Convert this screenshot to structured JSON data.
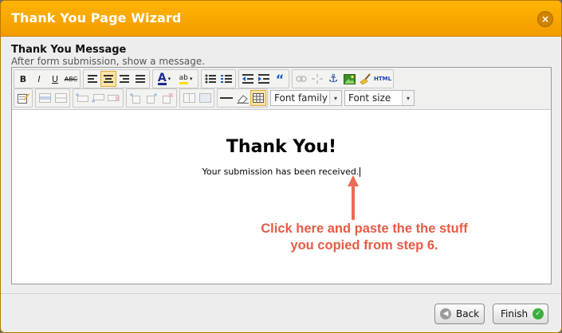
{
  "dialog": {
    "title": "Thank You Page Wizard",
    "close_symbol": "×"
  },
  "section": {
    "title": "Thank You Message",
    "subtitle": "After form submission, show a message."
  },
  "toolbar": {
    "bold": "B",
    "italic": "I",
    "underline": "U",
    "strike": "ABC",
    "font_color_letter": "A",
    "highlight_text": "ab",
    "html": "HTML",
    "font_family_label": "Font family",
    "font_size_label": "Font size",
    "blockquote": "“",
    "dropdown_arrow": "▾"
  },
  "editor": {
    "heading": "Thank You!",
    "body": "Your submission has been received."
  },
  "annotation": {
    "line1": "Click here and paste the the stuff",
    "line2": "you copied from step 6.",
    "color": "#e85a45"
  },
  "footer": {
    "back_label": "Back",
    "finish_label": "Finish",
    "back_symbol": "◀",
    "finish_symbol": "✓"
  }
}
